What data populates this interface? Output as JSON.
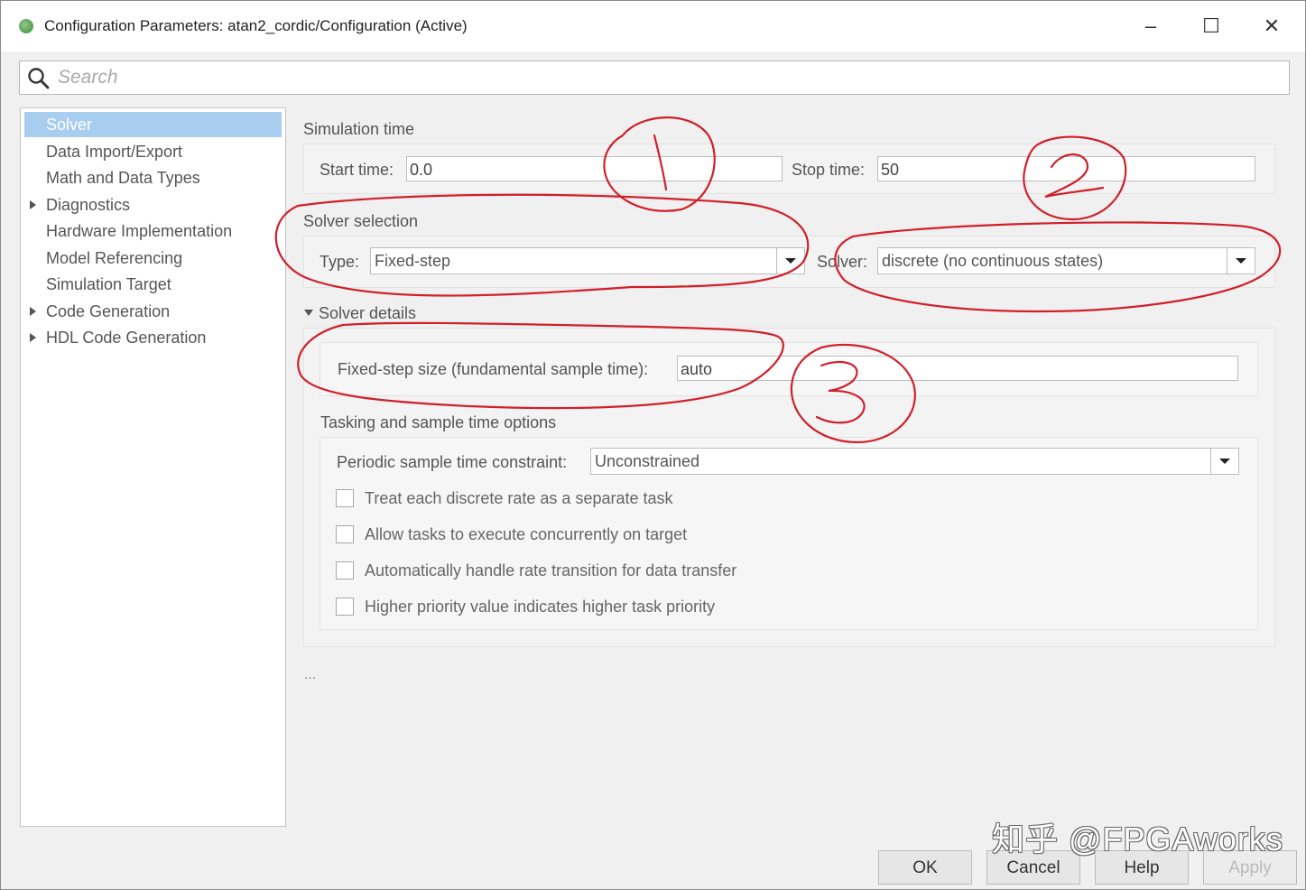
{
  "window": {
    "title": "Configuration Parameters: atan2_cordic/Configuration (Active)",
    "controls": {
      "minimize": "–",
      "maximize": "☐",
      "close": "✕"
    }
  },
  "search": {
    "placeholder": "Search"
  },
  "sidebar": {
    "items": [
      {
        "label": "Solver",
        "selected": true,
        "expandable": false
      },
      {
        "label": "Data Import/Export",
        "selected": false,
        "expandable": false
      },
      {
        "label": "Math and Data Types",
        "selected": false,
        "expandable": false
      },
      {
        "label": "Diagnostics",
        "selected": false,
        "expandable": true
      },
      {
        "label": "Hardware Implementation",
        "selected": false,
        "expandable": false
      },
      {
        "label": "Model Referencing",
        "selected": false,
        "expandable": false
      },
      {
        "label": "Simulation Target",
        "selected": false,
        "expandable": false
      },
      {
        "label": "Code Generation",
        "selected": false,
        "expandable": true
      },
      {
        "label": "HDL Code Generation",
        "selected": false,
        "expandable": true
      }
    ]
  },
  "simulation_time": {
    "title": "Simulation time",
    "start_label": "Start time:",
    "start_value": "0.0",
    "stop_label": "Stop time:",
    "stop_value": "50"
  },
  "solver_selection": {
    "title": "Solver selection",
    "type_label": "Type:",
    "type_value": "Fixed-step",
    "solver_label": "Solver:",
    "solver_value": "discrete (no continuous states)"
  },
  "solver_details": {
    "title": "Solver details",
    "fixed_step_label": "Fixed-step size (fundamental sample time):",
    "fixed_step_value": "auto"
  },
  "tasking": {
    "title": "Tasking and sample time options",
    "periodic_label": "Periodic sample time constraint:",
    "periodic_value": "Unconstrained",
    "checkboxes": [
      {
        "label": "Treat each discrete rate as a separate task",
        "checked": false
      },
      {
        "label": "Allow tasks to execute concurrently on target",
        "checked": false
      },
      {
        "label": "Automatically handle rate transition for data transfer",
        "checked": false
      },
      {
        "label": "Higher priority value indicates higher task priority",
        "checked": false
      }
    ]
  },
  "more_indicator": "...",
  "buttons": {
    "ok": "OK",
    "cancel": "Cancel",
    "help": "Help",
    "apply": "Apply"
  },
  "watermark": "知乎 @FPGAworks",
  "annotation_color": "#d0202a"
}
